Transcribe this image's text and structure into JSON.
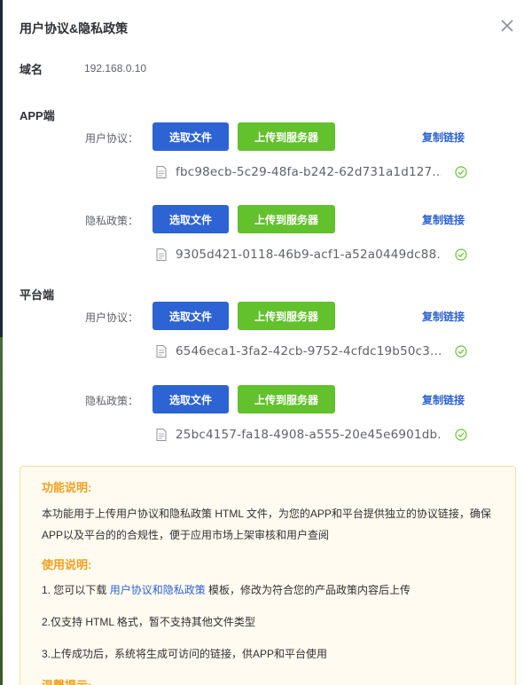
{
  "dialog": {
    "title": "用户协议&隐私政策",
    "domain_label": "域名",
    "domain_value": "192.168.0.10"
  },
  "sections": [
    {
      "title": "APP端",
      "rows": [
        {
          "label": "用户协议：",
          "select_label": "选取文件",
          "upload_label": "上传到服务器",
          "copy_label": "复制链接",
          "file_name": "fbc98ecb-5c29-48fa-b242-62d731a1d127...."
        },
        {
          "label": "隐私政策：",
          "select_label": "选取文件",
          "upload_label": "上传到服务器",
          "copy_label": "复制链接",
          "file_name": "9305d421-0118-46b9-acf1-a52a0449dc88..."
        }
      ]
    },
    {
      "title": "平台端",
      "rows": [
        {
          "label": "用户协议：",
          "select_label": "选取文件",
          "upload_label": "上传到服务器",
          "copy_label": "复制链接",
          "file_name": "6546eca1-3fa2-42cb-9752-4cfdc19b50c3...."
        },
        {
          "label": "隐私政策：",
          "select_label": "选取文件",
          "upload_label": "上传到服务器",
          "copy_label": "复制链接",
          "file_name": "25bc4157-fa18-4908-a555-20e45e6901db..."
        }
      ]
    }
  ],
  "info": {
    "func_heading": "功能说明:",
    "func_text": "本功能用于上传用户协议和隐私政策 HTML 文件，为您的APP和平台提供独立的协议链接，确保APP以及平台的的合规性，便于应用市场上架审核和用户查阅",
    "usage_heading": "使用说明:",
    "usage_1_prefix": "1. 您可以下载 ",
    "usage_1_link": "用户协议和隐私政策",
    "usage_1_suffix": " 模板，修改为符合您的产品政策内容后上传",
    "usage_2": "2.仅支持 HTML 格式，暂不支持其他文件类型",
    "usage_3": "3.上传成功后，系统将生成可访问的链接，供APP和平台使用",
    "tips_heading": "温馨提示:"
  },
  "colors": {
    "primary": "#2d63d2",
    "success": "#63c12d",
    "warning": "#f0a020"
  },
  "icons": [
    "close-icon",
    "file-icon",
    "check-circle-icon"
  ]
}
